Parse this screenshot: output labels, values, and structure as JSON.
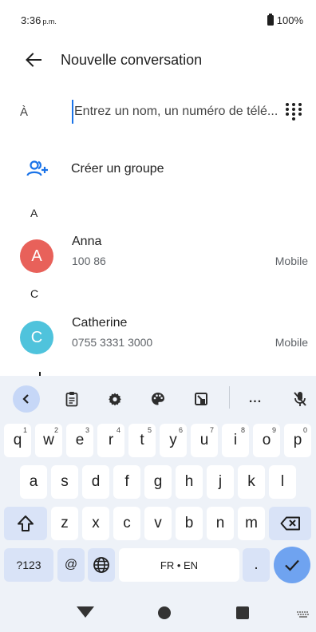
{
  "status_bar": {
    "time": "3:36",
    "ampm": "p.m.",
    "battery": "100%"
  },
  "app_bar": {
    "title": "Nouvelle conversation"
  },
  "to_field": {
    "label": "À",
    "placeholder": "Entrez un nom, un numéro de télé..."
  },
  "create_group": {
    "label": "Créer un groupe"
  },
  "sections": [
    {
      "letter": "A",
      "contacts": [
        {
          "initial": "A",
          "name": "Anna",
          "number": "100 86",
          "type": "Mobile",
          "color": "#e8615a"
        }
      ]
    },
    {
      "letter": "C",
      "contacts": [
        {
          "initial": "C",
          "name": "Catherine",
          "number": "0755 3331 3000",
          "type": "Mobile",
          "color": "#4fc3dc"
        }
      ]
    }
  ],
  "keyboard": {
    "row1": [
      {
        "k": "q",
        "s": "1"
      },
      {
        "k": "w",
        "s": "2"
      },
      {
        "k": "e",
        "s": "3"
      },
      {
        "k": "r",
        "s": "4"
      },
      {
        "k": "t",
        "s": "5"
      },
      {
        "k": "y",
        "s": "6"
      },
      {
        "k": "u",
        "s": "7"
      },
      {
        "k": "i",
        "s": "8"
      },
      {
        "k": "o",
        "s": "9"
      },
      {
        "k": "p",
        "s": "0"
      }
    ],
    "row2": [
      "a",
      "s",
      "d",
      "f",
      "g",
      "h",
      "j",
      "k",
      "l"
    ],
    "row3": [
      "z",
      "x",
      "c",
      "v",
      "b",
      "n",
      "m"
    ],
    "symbols_label": "?123",
    "at_label": "@",
    "space_label": "FR • EN",
    "period_label": ".",
    "more_label": "..."
  },
  "colors": {
    "accent": "#1a73e8",
    "keyboard_bg": "#eef2f8",
    "enter_key": "#6fa3f0"
  }
}
